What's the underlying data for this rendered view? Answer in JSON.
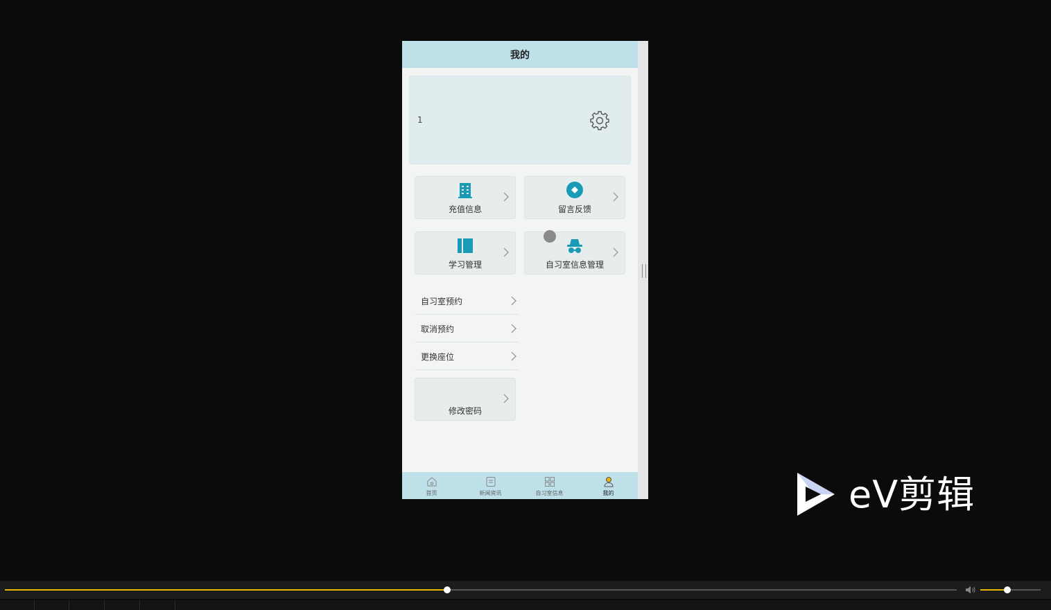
{
  "app": {
    "header_title": "我的"
  },
  "profile": {
    "name": "1",
    "settings_icon": "gear-icon"
  },
  "tiles": [
    {
      "label": "充值信息",
      "icon": "building-icon",
      "color": "#1a9bb5"
    },
    {
      "label": "留言反馈",
      "icon": "diamond-circle-icon",
      "color": "#1a9bb5"
    },
    {
      "label": "学习管理",
      "icon": "book-icon",
      "color": "#1a9bb5"
    },
    {
      "label": "自习室信息管理",
      "icon": "incognito-icon",
      "color": "#1a9bb5"
    }
  ],
  "list": [
    {
      "label": "自习室预约"
    },
    {
      "label": "取消预约"
    },
    {
      "label": "更换座位"
    }
  ],
  "password_tile": {
    "label": "修改密码"
  },
  "tabbar": [
    {
      "label": "首页",
      "icon": "home-icon",
      "active": false
    },
    {
      "label": "新闻资讯",
      "icon": "news-icon",
      "active": false
    },
    {
      "label": "自习室信息",
      "icon": "grid-icon",
      "active": false
    },
    {
      "label": "我的",
      "icon": "user-icon",
      "active": true
    }
  ],
  "watermark": {
    "text": "eV剪辑",
    "icon": "ev-play-logo-icon"
  },
  "player": {
    "progress": 0.42,
    "volume": 0.46,
    "accent": "#e6b800"
  },
  "colors": {
    "header_bg": "#bde0e9",
    "accent": "#1a9bb5",
    "page_bg": "#f3f4f4"
  }
}
